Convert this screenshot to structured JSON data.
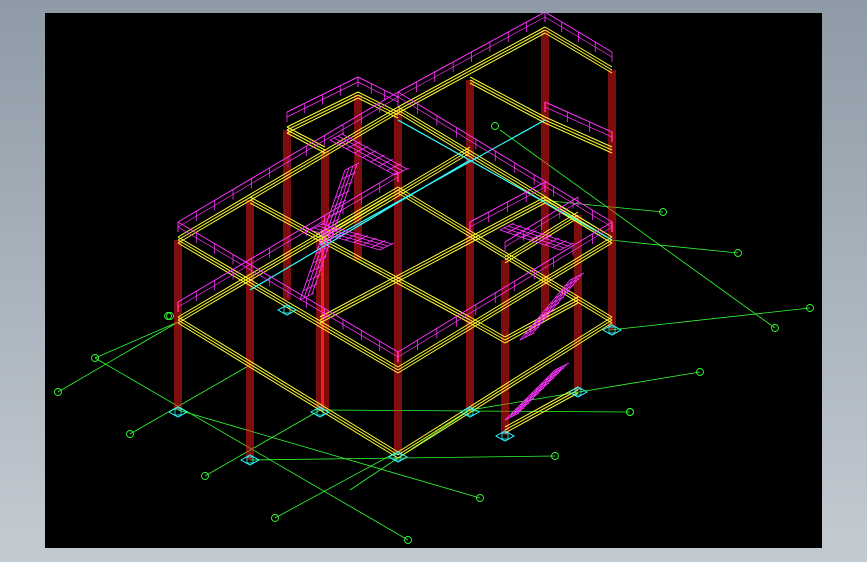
{
  "viewer": {
    "background_color": "#000000",
    "frame_color": "#a6b0ba"
  },
  "model": {
    "type": "isometric steel frame wireframe (CAD)",
    "layer_colors": {
      "columns": "#ff1a1a",
      "beams": "#ffff33",
      "railings": "#ff33ff",
      "stairs": "#ff33ff",
      "grid_lines": "#33ff33",
      "base_plates": "#33ffff",
      "tie_beams": "#33ffff"
    },
    "grid_markers": 18
  }
}
